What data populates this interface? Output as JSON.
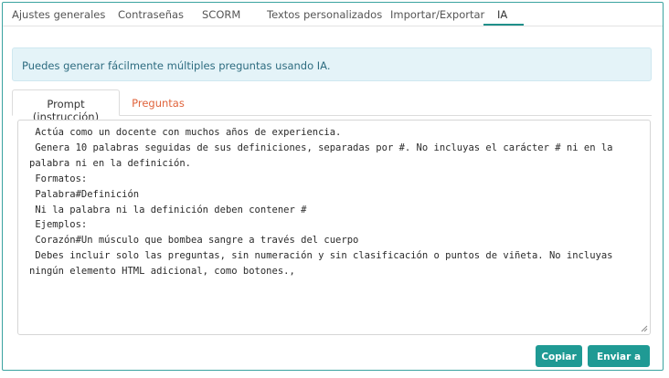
{
  "top_tabs": [
    {
      "label": "Ajustes generales",
      "active": false
    },
    {
      "label": "Contraseñas",
      "active": false
    },
    {
      "label": "SCORM",
      "active": false
    },
    {
      "label": "Textos personalizados",
      "active": false
    },
    {
      "label": "Importar/Exportar",
      "active": false
    },
    {
      "label": "IA",
      "active": true
    }
  ],
  "info": {
    "message": "Puedes generar fácilmente múltiples preguntas usando IA."
  },
  "sub_tabs": [
    {
      "label": "Prompt (instrucción)",
      "active": true
    },
    {
      "label": "Preguntas",
      "active": false
    }
  ],
  "prompt": {
    "text": " Actúa como un docente con muchos años de experiencia.\n Genera 10 palabras seguidas de sus definiciones, separadas por #. No incluyas el carácter # ni en la palabra ni en la definición.\n Formatos:\n Palabra#Definición\n Ni la palabra ni la definición deben contener #\n Ejemplos:\n Corazón#Un músculo que bombea sangre a través del cuerpo\n Debes incluir solo las preguntas, sin numeración y sin clasificación o puntos de viñeta. No incluyas ningún elemento HTML adicional, como botones.,"
  },
  "buttons": {
    "copy_label": "Copiar",
    "send_label": "Enviar a IA"
  },
  "colors": {
    "accent": "#1f9a94",
    "info_bg": "#e4f3f8",
    "inactive_tab": "#e0643c"
  }
}
